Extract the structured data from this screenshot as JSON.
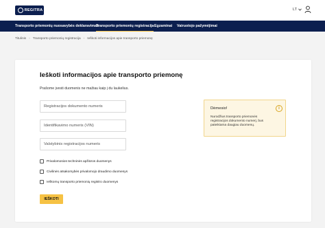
{
  "header": {
    "logo_text": "REGITRA",
    "language": "LT"
  },
  "nav": {
    "items": [
      {
        "label": "Transporto priemonių nuosavybės deklaravimas"
      },
      {
        "label": "Transporto priemonių registracija"
      },
      {
        "label": "Egzaminai"
      },
      {
        "label": "Vairuotojo pažymėjimai"
      }
    ],
    "active_index": 1
  },
  "breadcrumb": {
    "items": [
      "Titulinis",
      "Transporto priemonių registracija",
      "Ieškoti informacijos apie transporto priemonę"
    ],
    "separator": "›"
  },
  "form": {
    "title": "Ieškoti informacijos apie transporto priemonę",
    "hint": "Prašome įvesti duomenis ne mažiau kaip į du laukelius.",
    "fields": [
      {
        "placeholder": "Registracijos dokumento numeris",
        "value": ""
      },
      {
        "placeholder": "Identifikavimo numeris (VIN)",
        "value": ""
      },
      {
        "placeholder": "Valstybinis registracijos numeris",
        "value": ""
      }
    ],
    "checkboxes": [
      {
        "label": "Privalomosios techninės apžiūros duomenys",
        "checked": false
      },
      {
        "label": "Civilinės atsakomybės privalomojo draudimo duomenys",
        "checked": false
      },
      {
        "label": "Ieškomų transporto priemonių registro duomenys",
        "checked": false
      }
    ],
    "submit_label": "IEŠKOTI"
  },
  "notice": {
    "title": "Dėmesio!",
    "text": "Nurodžius transporto priemonės registracijos dokumento numerį, bus pateikiama daugiau duomenų.",
    "icon": "info-icon"
  },
  "colors": {
    "brand": "#0c1f4f",
    "accent": "#f6c244",
    "notice_bg": "#fdf6e3"
  }
}
